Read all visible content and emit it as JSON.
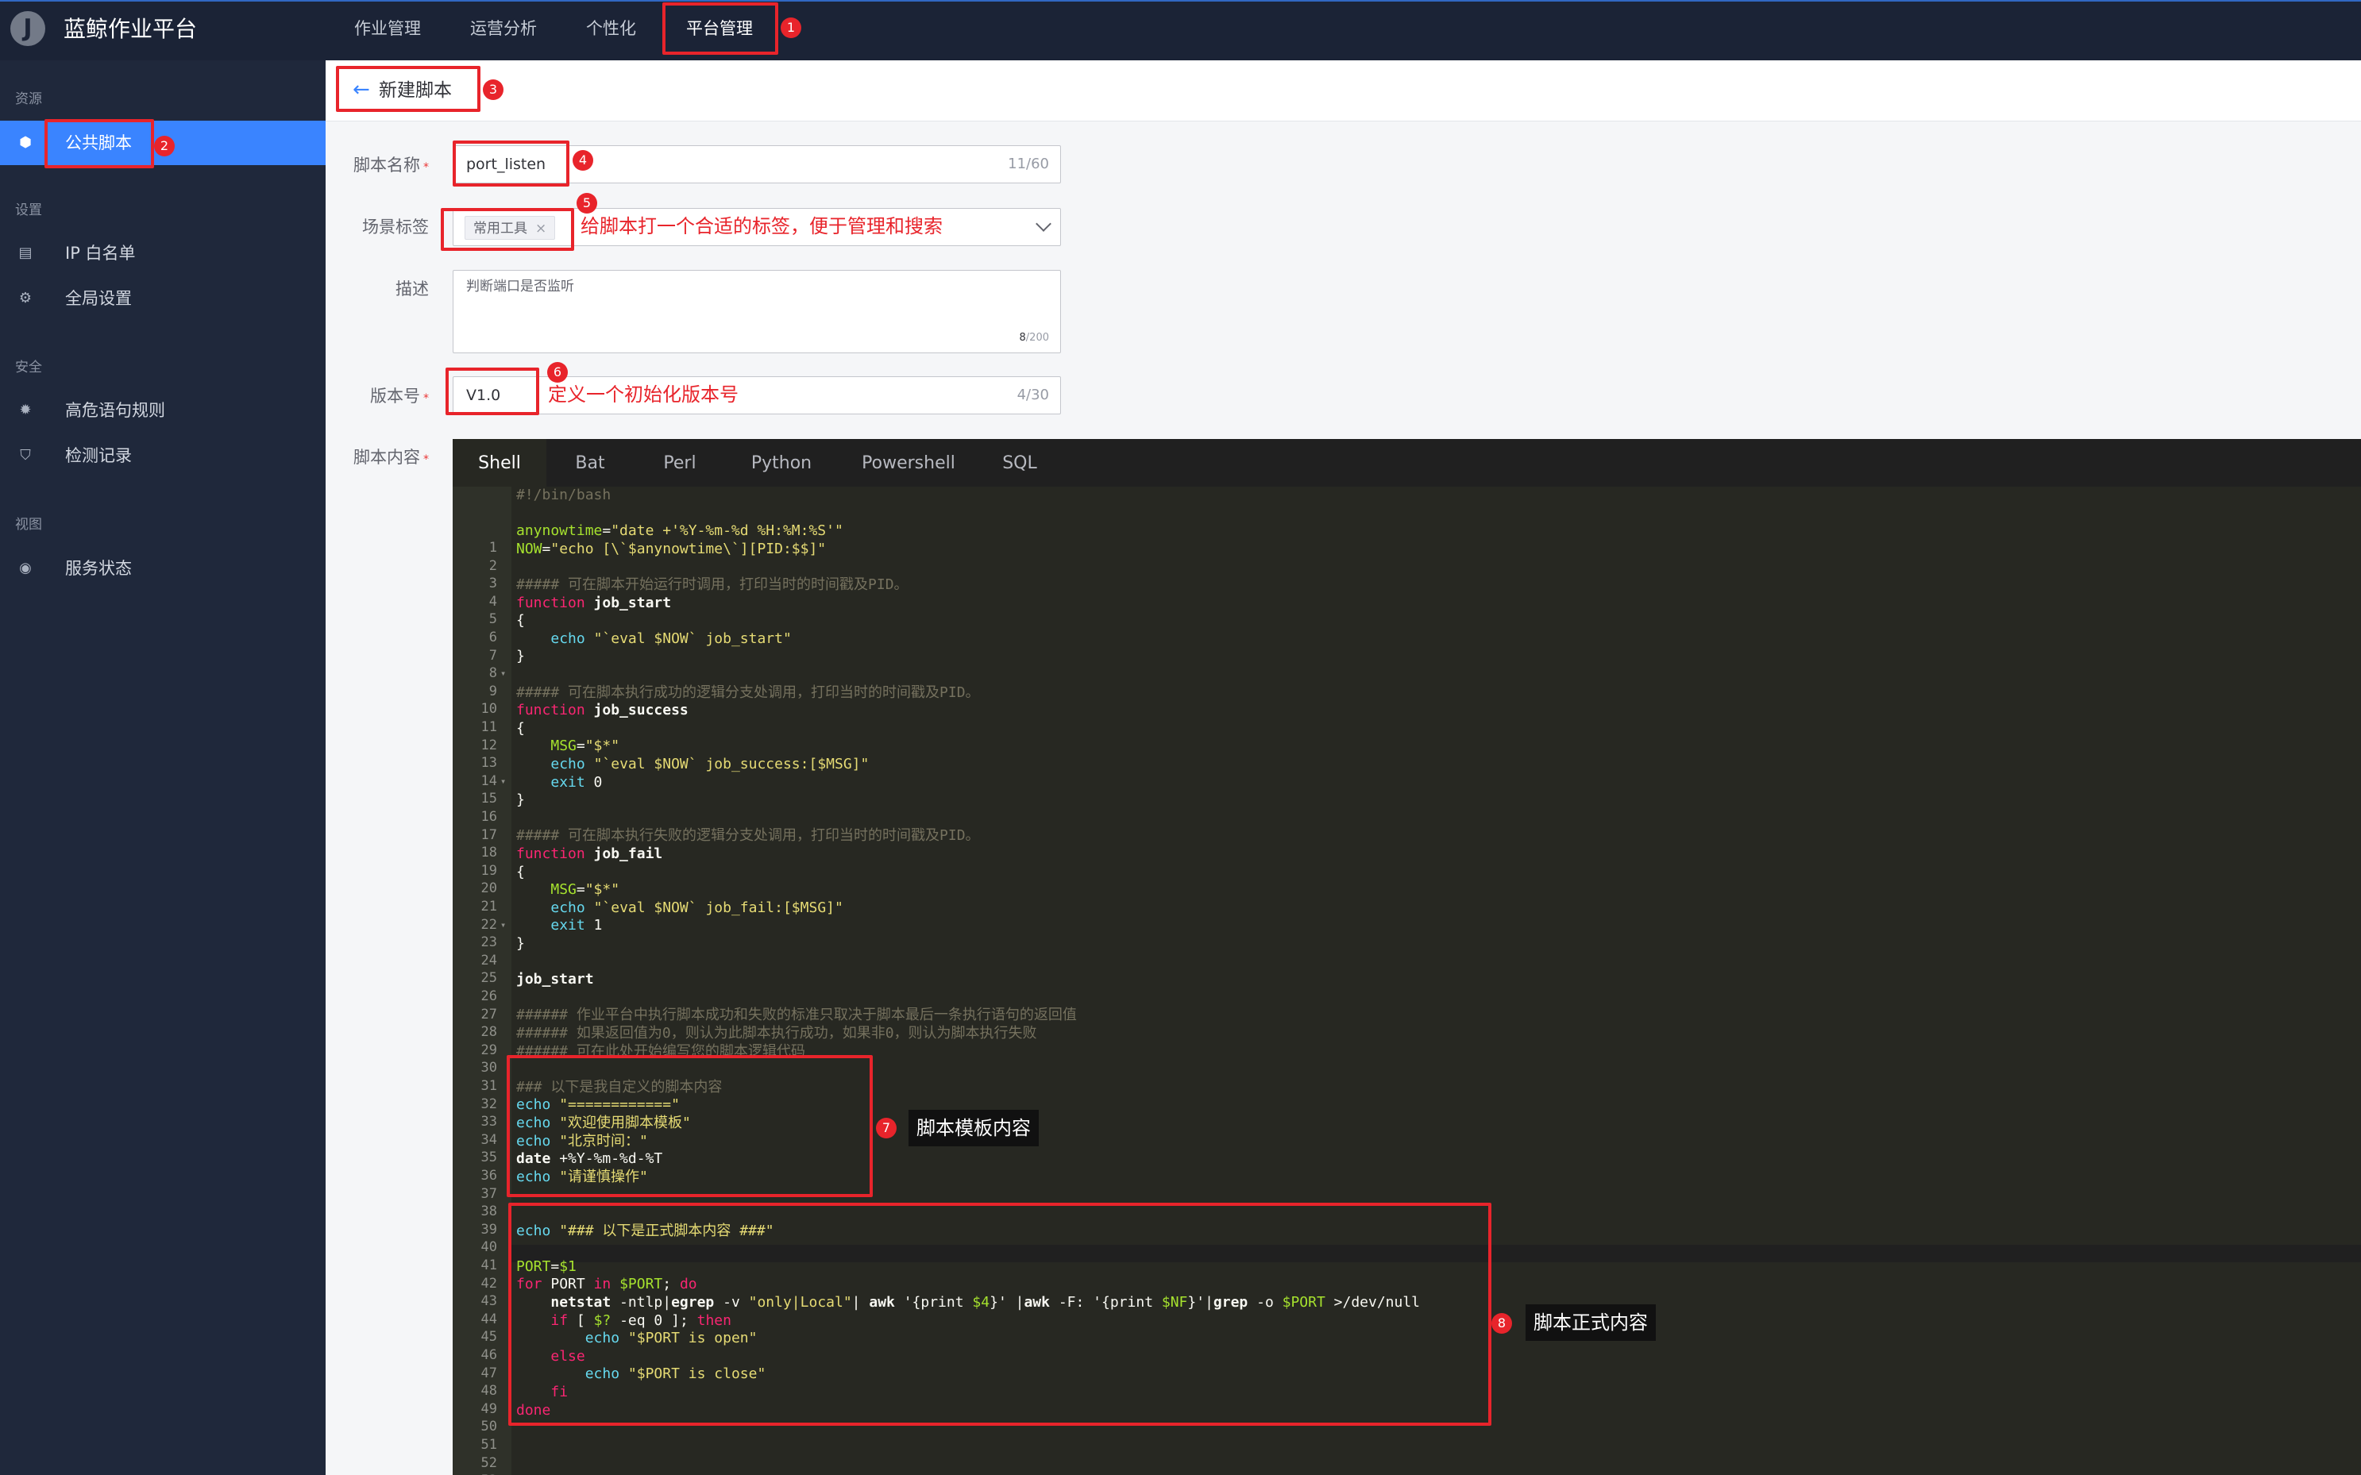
{
  "app": {
    "logo_letter": "J",
    "title": "蓝鲸作业平台"
  },
  "nav": [
    "作业管理",
    "运营分析",
    "个性化",
    "平台管理"
  ],
  "sidebar": {
    "groups": [
      "资源",
      "设置",
      "安全",
      "视图"
    ],
    "items": [
      {
        "label": "公共脚本",
        "icon": "cube-icon"
      },
      {
        "label": "IP 白名单",
        "icon": "document-icon"
      },
      {
        "label": "全局设置",
        "icon": "gear-icon"
      },
      {
        "label": "高危语句规则",
        "icon": "bug-icon"
      },
      {
        "label": "检测记录",
        "icon": "shield-icon"
      },
      {
        "label": "服务状态",
        "icon": "status-icon"
      }
    ]
  },
  "page": {
    "back": "←",
    "title": "新建脚本"
  },
  "form": {
    "name_label": "脚本名称",
    "name_value": "port_listen",
    "name_count": "11/60",
    "tag_label": "场景标签",
    "tag_value": "常用工具",
    "tag_close": "×",
    "desc_label": "描述",
    "desc_value": "判断端口是否监听",
    "desc_count_used": "8",
    "desc_count_total": "/200",
    "version_label": "版本号",
    "version_value": "V1.0",
    "version_count": "4/30",
    "content_label": "脚本内容",
    "required_mark": "*"
  },
  "editor": {
    "tabs": [
      "Shell",
      "Bat",
      "Perl",
      "Python",
      "Powershell",
      "SQL"
    ],
    "lines": [
      "#!/bin/bash",
      "",
      "anynowtime=\"date +'%Y-%m-%d %H:%M:%S'\"",
      "NOW=\"echo [\\`$anynowtime\\`][PID:$$]\"",
      "",
      "##### 可在脚本开始运行时调用，打印当时的时间戳及PID。",
      "function job_start",
      "{",
      "    echo \"`eval $NOW` job_start\"",
      "}",
      "",
      "##### 可在脚本执行成功的逻辑分支处调用，打印当时的时间戳及PID。",
      "function job_success",
      "{",
      "    MSG=\"$*\"",
      "    echo \"`eval $NOW` job_success:[$MSG]\"",
      "    exit 0",
      "}",
      "",
      "##### 可在脚本执行失败的逻辑分支处调用，打印当时的时间戳及PID。",
      "function job_fail",
      "{",
      "    MSG=\"$*\"",
      "    echo \"`eval $NOW` job_fail:[$MSG]\"",
      "    exit 1",
      "}",
      "",
      "job_start",
      "",
      "###### 作业平台中执行脚本成功和失败的标准只取决于脚本最后一条执行语句的返回值",
      "###### 如果返回值为0，则认为此脚本执行成功，如果非0，则认为脚本执行失败",
      "###### 可在此处开始编写您的脚本逻辑代码",
      "",
      "### 以下是我自定义的脚本内容",
      "echo \"============\"",
      "echo \"欢迎使用脚本模板\"",
      "echo \"北京时间：\"",
      "date +%Y-%m-%d-%T",
      "echo \"请谨慎操作\"",
      "",
      "",
      "echo \"### 以下是正式脚本内容 ###\"",
      "",
      "PORT=$1",
      "for PORT in $PORT; do",
      "    netstat -ntlp|egrep -v \"only|Local\"| awk '{print $4}' |awk -F: '{print $NF}'|grep -o $PORT >/dev/null",
      "    if [ $? -eq 0 ]; then",
      "        echo \"$PORT is open\"",
      "    else",
      "        echo \"$PORT is close\"",
      "    fi",
      "done",
      ""
    ]
  },
  "annotations": {
    "badges": [
      "1",
      "2",
      "3",
      "4",
      "5",
      "6",
      "7",
      "8"
    ],
    "tag_note": "给脚本打一个合适的标签，便于管理和搜索",
    "version_note": "定义一个初始化版本号",
    "template_note": "脚本模板内容",
    "formal_note": "脚本正式内容"
  },
  "colors": {
    "topbar": "#1b2336",
    "sidebar": "#1f283b",
    "accent": "#3a84ff",
    "annotation_red": "#e8242b",
    "editor_bg": "#272822"
  }
}
